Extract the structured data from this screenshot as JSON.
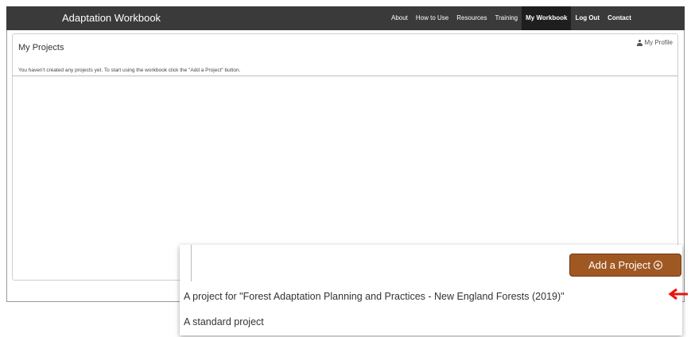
{
  "navbar": {
    "brand": "Adaptation Workbook",
    "links": [
      {
        "label": "About"
      },
      {
        "label": "How to Use"
      },
      {
        "label": "Resources"
      },
      {
        "label": "Training"
      },
      {
        "label": "My Workbook",
        "active": true
      },
      {
        "label": "Log Out"
      },
      {
        "label": "Contact"
      }
    ]
  },
  "panel": {
    "title": "My Projects",
    "profile_label": "My Profile",
    "notice": "You haven't created any projects yet.  To start using the workbook click the \"Add a Project\" button."
  },
  "add_project": {
    "label": "Add a Project",
    "options": [
      "A project for \"Forest Adaptation Planning and Practices - New England Forests (2019)\"",
      "A standard project"
    ]
  },
  "annotation": {
    "arrow_color": "#e8140c"
  },
  "colors": {
    "navbar": "#3a3a3a",
    "button": "#a05823"
  }
}
